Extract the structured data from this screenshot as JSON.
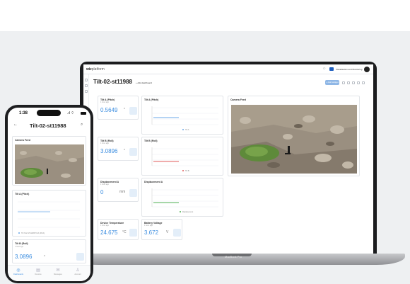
{
  "laptop": {
    "brand_label": "MacBook Pro"
  },
  "web": {
    "logo": {
      "primary": "wiz",
      "secondary": "platform"
    },
    "org": "Visualisation and Monitoring",
    "dashboard_title": "Tilt-02-st11988",
    "add_dashboard": "+ Add dashboard",
    "new_widget": "+ Add widget",
    "widgets": {
      "tilt_a": {
        "title": "Tilt A (Pitch)",
        "sub": "1 hour ago",
        "value": "0.5649",
        "unit": "°"
      },
      "tilt_b": {
        "title": "Tilt B (Roll)",
        "sub": "1 hour ago",
        "value": "3.0896",
        "unit": "°"
      },
      "disp_a": {
        "title": "Displacement A",
        "sub": "1 hour ago",
        "value": "0",
        "unit": "mm"
      },
      "chart_a": {
        "title": "Tilt A (Pitch)",
        "legend": "Tilt A"
      },
      "chart_b": {
        "title": "Tilt B (Roll)",
        "legend": "Tilt B"
      },
      "chart_disp": {
        "title": "Displacement A",
        "legend": "Displacement"
      },
      "camera": {
        "title": "Camera Feed"
      },
      "temp": {
        "title": "Device Temperature",
        "sub": "1 hour ago",
        "value": "24.675",
        "unit": "°C"
      },
      "battery": {
        "title": "Battery Voltage",
        "sub": "1 hour ago",
        "value": "3.672",
        "unit": "V"
      }
    }
  },
  "phone": {
    "time": "1:38",
    "title": "Tilt-02-st11988",
    "camera_title": "Camera Feed",
    "tilt_a_title": "Tilt A (Pitch)",
    "tilt_a_legend": "TILT-02-ST11988 Tilt A (Pitch)",
    "tilt_b_title": "Tilt B (Roll)",
    "tilt_b_sub": "1 hour ago",
    "tilt_b_value": "3.0896",
    "tilt_b_unit": "°",
    "nav": [
      "Dashboards",
      "Devices",
      "Messages",
      "Account"
    ]
  },
  "colors": {
    "accent": "#3d8ee0",
    "line_blue": "#6aa7e8",
    "line_red": "#e05a5a",
    "line_green": "#4caf50"
  }
}
